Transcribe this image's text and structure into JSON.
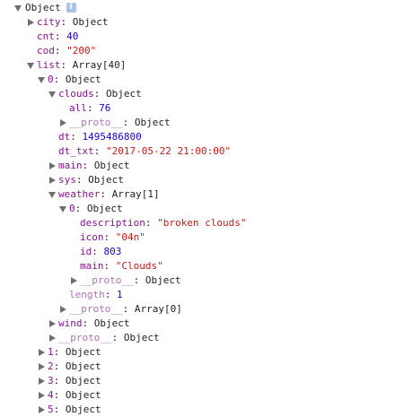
{
  "root": {
    "label": "Object",
    "info_icon": "i"
  },
  "items": {
    "city": {
      "key": "city",
      "value": "Object"
    },
    "cnt": {
      "key": "cnt",
      "value": "40"
    },
    "cod": {
      "key": "cod",
      "value": "\"200\""
    },
    "list": {
      "key": "list",
      "value": "Array[40]"
    },
    "i0": {
      "key": "0",
      "value": "Object"
    },
    "clouds": {
      "key": "clouds",
      "value": "Object"
    },
    "all": {
      "key": "all",
      "value": "76"
    },
    "proto1": {
      "key": "__proto__",
      "value": "Object"
    },
    "dt": {
      "key": "dt",
      "value": "1495486800"
    },
    "dt_txt": {
      "key": "dt_txt",
      "value": "\"2017-05-22 21:00:00\""
    },
    "main": {
      "key": "main",
      "value": "Object"
    },
    "sys": {
      "key": "sys",
      "value": "Object"
    },
    "weather": {
      "key": "weather",
      "value": "Array[1]"
    },
    "w0": {
      "key": "0",
      "value": "Object"
    },
    "desc": {
      "key": "description",
      "value": "\"broken clouds\""
    },
    "icon": {
      "key": "icon",
      "value": "\"04n\""
    },
    "id": {
      "key": "id",
      "value": "803"
    },
    "wmain": {
      "key": "main",
      "value": "\"Clouds\""
    },
    "proto2": {
      "key": "__proto__",
      "value": "Object"
    },
    "length": {
      "key": "length",
      "value": "1"
    },
    "proto3": {
      "key": "__proto__",
      "value": "Array[0]"
    },
    "wind": {
      "key": "wind",
      "value": "Object"
    },
    "proto4": {
      "key": "__proto__",
      "value": "Object"
    },
    "i1": {
      "key": "1",
      "value": "Object"
    },
    "i2": {
      "key": "2",
      "value": "Object"
    },
    "i3": {
      "key": "3",
      "value": "Object"
    },
    "i4": {
      "key": "4",
      "value": "Object"
    },
    "i5": {
      "key": "5",
      "value": "Object"
    }
  },
  "separator": ": ",
  "icons": {
    "collapsed": "triangle-right-icon",
    "expanded": "triangle-down-icon",
    "info": "info-badge-icon"
  },
  "colors": {
    "key": "#881391",
    "key_dimmed": "#b071b6",
    "number": "#1c00cf",
    "string": "#c41a16",
    "text": "#222222",
    "toggle": "#6e6e6e",
    "info_badge": "#a9c3e8"
  }
}
